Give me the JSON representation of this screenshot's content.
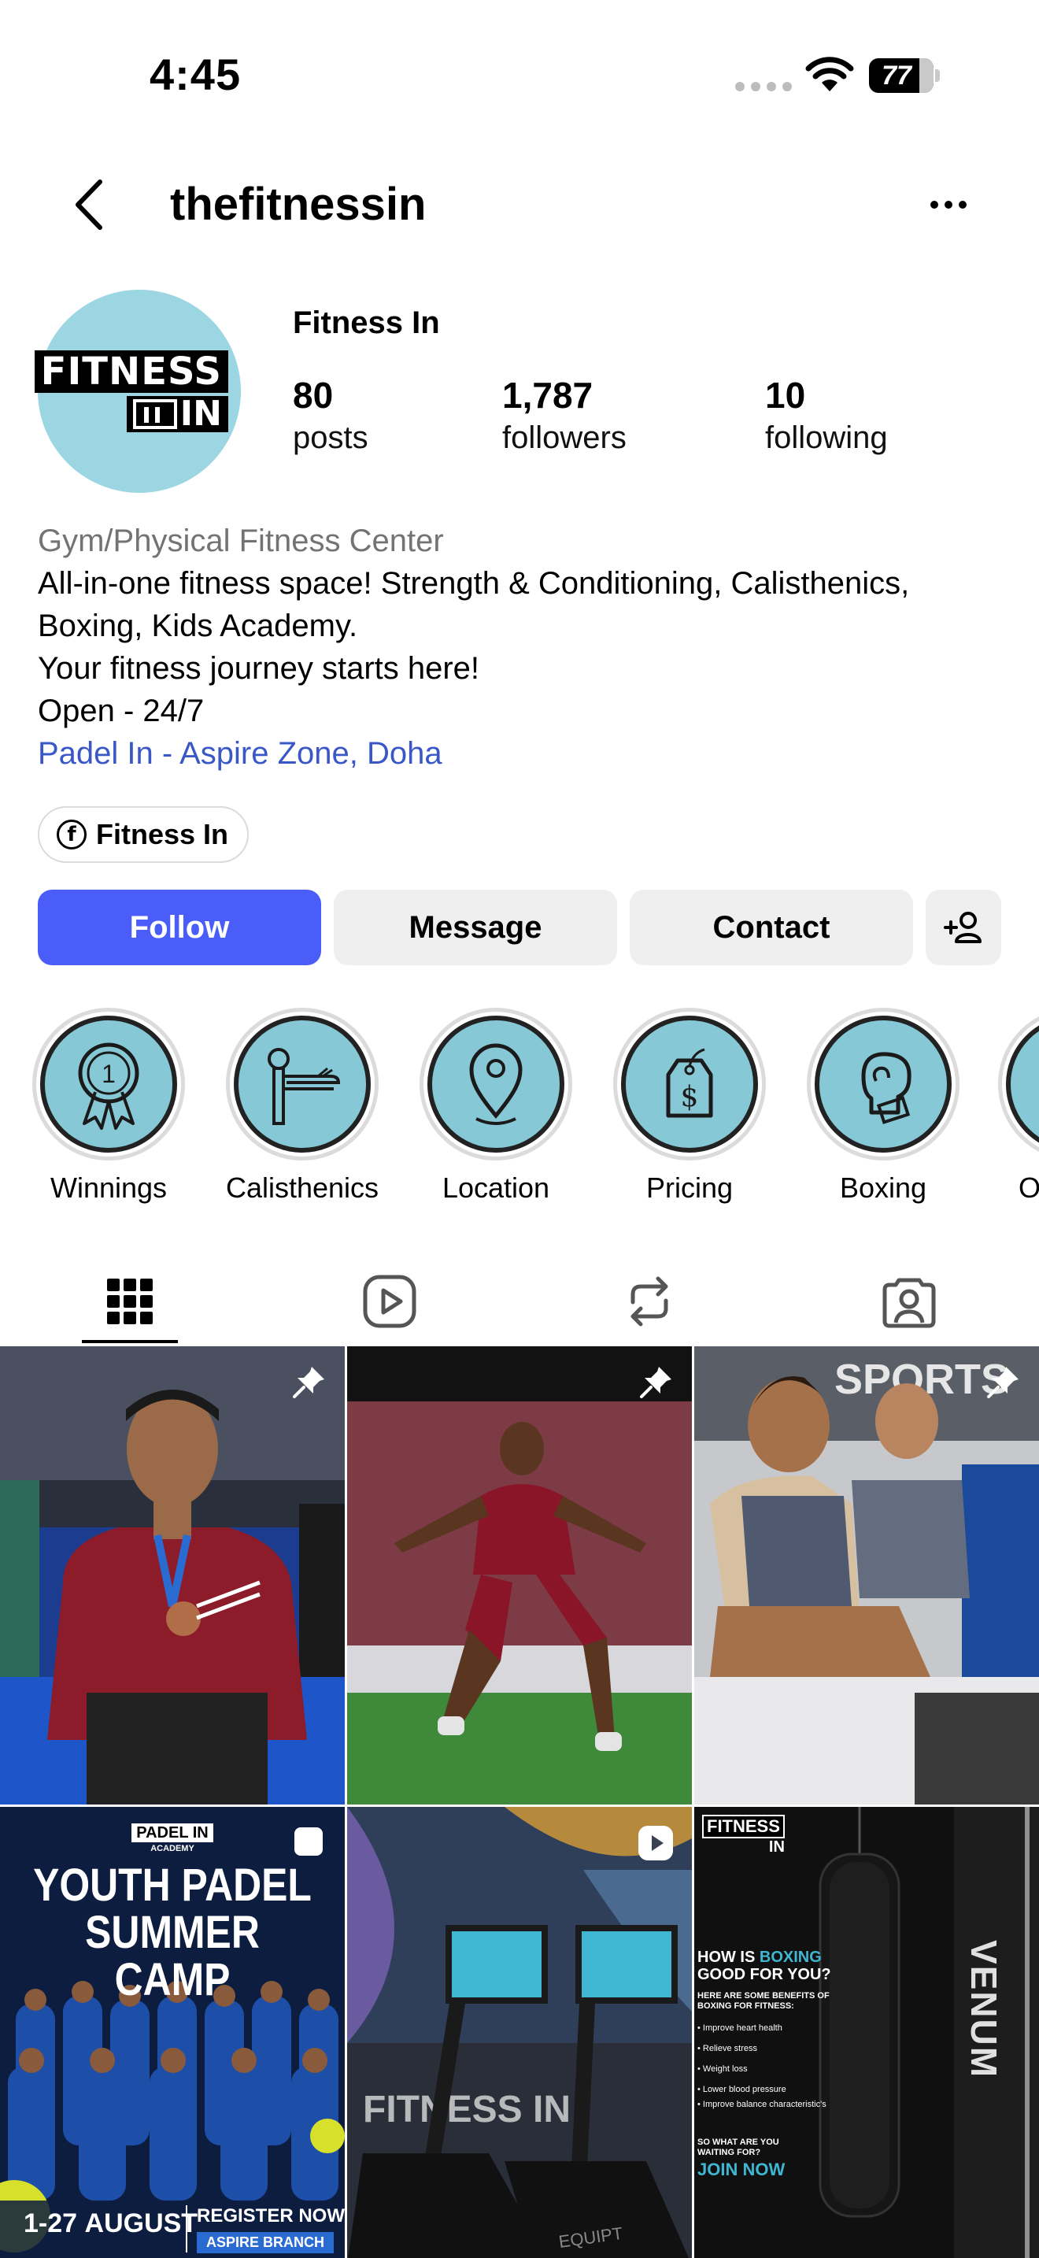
{
  "status_bar": {
    "time": "4:45",
    "battery": "77"
  },
  "header": {
    "username": "thefitnessin"
  },
  "profile": {
    "display_name": "Fitness In",
    "avatar_logo_top": "FITNESS",
    "avatar_logo_bottom": "IN",
    "stats": [
      {
        "value": "80",
        "label": "posts"
      },
      {
        "value": "1,787",
        "label": "followers"
      },
      {
        "value": "10",
        "label": "following"
      }
    ],
    "bio": {
      "category": "Gym/Physical Fitness Center",
      "lines": [
        "All-in-one fitness space! Strength & Conditioning, Calisthenics,",
        "Boxing, Kids Academy.",
        "Your fitness journey starts here!",
        "Open - 24/7"
      ],
      "location_link": "Padel In - Aspire Zone, Doha"
    },
    "facebook_chip": "Fitness In"
  },
  "actions": {
    "follow": "Follow",
    "message": "Message",
    "contact": "Contact"
  },
  "highlights": [
    {
      "label": "Winnings",
      "icon": "medal-icon"
    },
    {
      "label": "Calisthenics",
      "icon": "parallel-bars-icon"
    },
    {
      "label": "Location",
      "icon": "location-pin-icon"
    },
    {
      "label": "Pricing",
      "icon": "price-tag-icon"
    },
    {
      "label": "Boxing",
      "icon": "boxing-glove-icon"
    },
    {
      "label": "O",
      "icon": "highlight-icon"
    }
  ],
  "tabs": [
    {
      "name": "posts-grid",
      "icon": "grid-icon"
    },
    {
      "name": "reels",
      "icon": "reels-icon"
    },
    {
      "name": "reposts",
      "icon": "repost-icon"
    },
    {
      "name": "tagged",
      "icon": "tagged-user-icon"
    }
  ],
  "posts": [
    {
      "type": "pinned",
      "icon": "pin-icon"
    },
    {
      "type": "pinned",
      "icon": "pin-icon"
    },
    {
      "type": "pinned",
      "icon": "pin-icon",
      "overlay_text": "SPORTS"
    },
    {
      "type": "carousel",
      "icon": "carousel-icon",
      "brand": "PADEL IN",
      "brand_sub": "ACADEMY",
      "title_line1": "YOUTH PADEL",
      "title_line2": "SUMMER CAMP",
      "dates_num": "1-27",
      "dates_month": "AUGUST",
      "register": "REGISTER NOW",
      "branch": "ASPIRE BRANCH"
    },
    {
      "type": "reel",
      "icon": "reel-play-icon",
      "wall_text": "FITNESS IN",
      "wall_text_top": "NESS IN",
      "machine_text": "EQUIPT"
    },
    {
      "type": "post",
      "logo_top": "FITNESS",
      "logo_bottom": "IN",
      "heading_pre": "HOW IS ",
      "heading_highlight": "BOXING",
      "heading_post": "GOOD FOR YOU?",
      "intro": "HERE ARE SOME BENEFITS OF BOXING FOR FITNESS:",
      "benefits": [
        "Improve heart health",
        "Relieve stress",
        "Weight loss",
        "Lower blood pressure",
        "Improve balance characteristic's"
      ],
      "cta_small": "SO WHAT ARE YOU WAITING FOR?",
      "cta_big": "JOIN NOW",
      "bag_text": "VENUM"
    }
  ],
  "colors": {
    "follow_blue": "#4a5df9",
    "link_blue": "#3a57c8",
    "highlight_fill": "#86c8d6",
    "avatar_bg": "#9bd6e2"
  }
}
